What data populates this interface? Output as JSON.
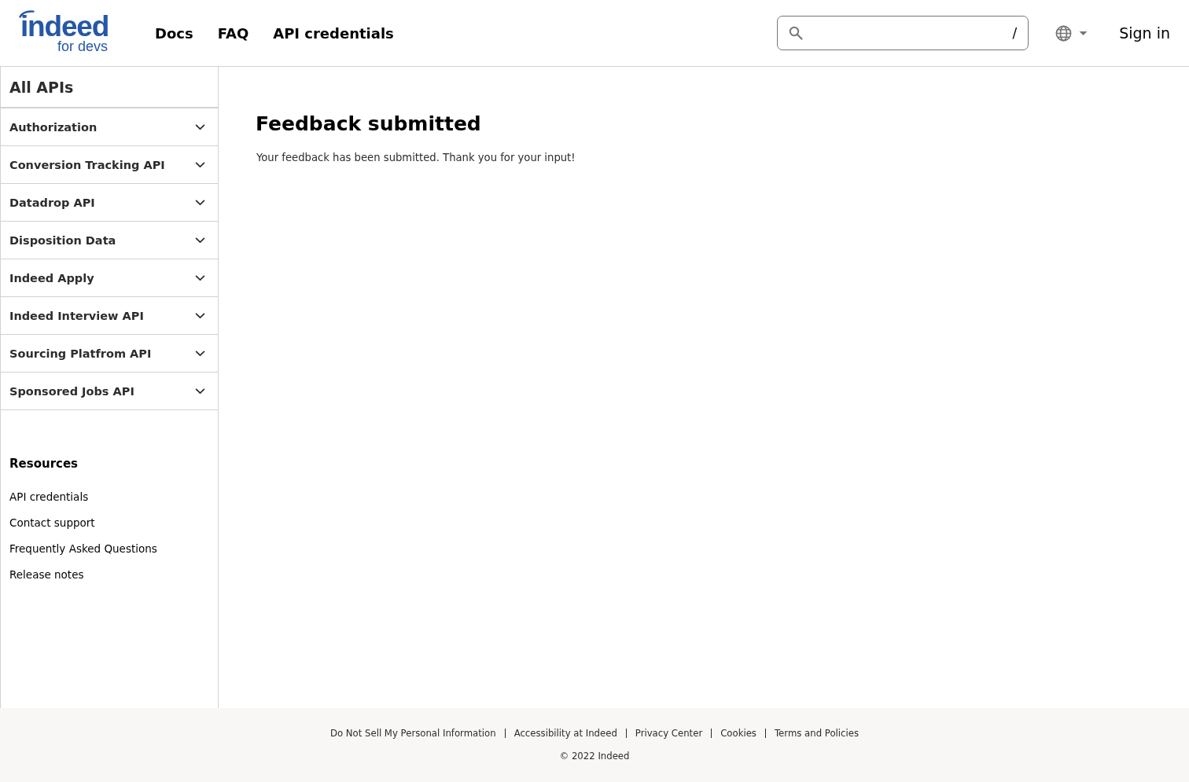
{
  "header": {
    "logo": {
      "wordmark": "indeed",
      "tagline": "for devs"
    },
    "nav": [
      "Docs",
      "FAQ",
      "API credentials"
    ],
    "search": {
      "shortcut": "/"
    },
    "sign_in": "Sign in"
  },
  "sidebar": {
    "title": "All APIs",
    "items": [
      {
        "label": "Authorization",
        "expanded": false
      },
      {
        "label": "Conversion Tracking API",
        "expanded": false
      },
      {
        "label": "Datadrop API",
        "expanded": false
      },
      {
        "label": "Disposition Data",
        "expanded": false
      },
      {
        "label": "Indeed Apply",
        "expanded": false
      },
      {
        "label": "Indeed Interview API",
        "expanded": false
      },
      {
        "label": "Sourcing Platfrom API",
        "expanded": false
      },
      {
        "label": "Sponsored Jobs API",
        "expanded": false
      }
    ],
    "resources": {
      "heading": "Resources",
      "links": [
        "API credentials",
        "Contact support",
        "Frequently Asked Questions",
        "Release notes"
      ]
    }
  },
  "main": {
    "title": "Feedback submitted",
    "message": "Your feedback has been submitted. Thank you for your input!"
  },
  "footer": {
    "links": [
      "Do Not Sell My Personal Information",
      "Accessibility at Indeed",
      "Privacy Center",
      "Cookies",
      "Terms and Policies"
    ],
    "copyright": "© 2022 Indeed"
  }
}
